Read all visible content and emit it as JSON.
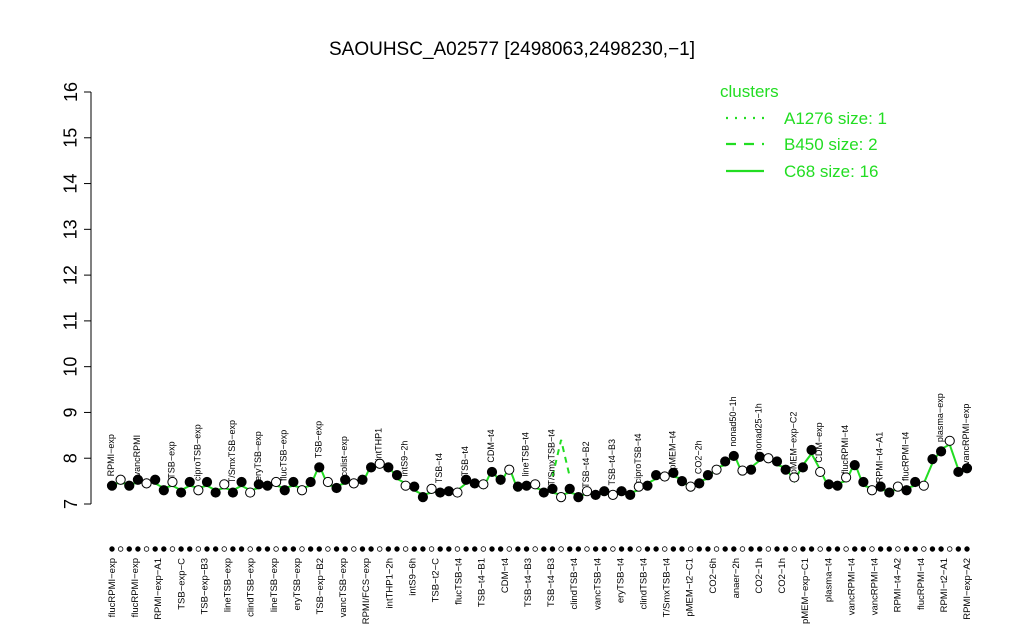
{
  "chart_data": {
    "type": "line",
    "title": "SAOUHSC_A02577 [2498063,2498230,−1]",
    "xlabel": "",
    "ylabel": "",
    "ylim": [
      7,
      16
    ],
    "yticks": [
      "7",
      "8",
      "9",
      "10",
      "11",
      "12",
      "13",
      "14",
      "15",
      "16"
    ],
    "grid": false,
    "legend": {
      "title": "clusters",
      "position": "top-right",
      "entries": [
        {
          "label": "A1276 size: 1",
          "style": "dotted"
        },
        {
          "label": "B450 size: 2",
          "style": "dashed"
        },
        {
          "label": "C68 size: 16",
          "style": "solid"
        }
      ]
    },
    "line_color": "#22dd22",
    "x_tick_labels": [
      "flucRPMI−exp",
      "flucRPMI−exp",
      "RPMI−exp−A1",
      "TSB−exp−C",
      "TSB−exp−B3",
      "lineTSB−exp",
      "clindTSB−exp",
      "lineTSB−exp",
      "eryTSB−exp",
      "TSB−exp−B2",
      "vancTSB−exp",
      "RPMI/FCS−exp",
      "intTHP1−2h",
      "intS9−6h",
      "TSB−t2−C",
      "flucTSB−t4",
      "TSB−t4−B1",
      "CDM−t4",
      "TSB−t4−B3",
      "TSB−t4−B3",
      "clindTSB−t4",
      "vancTSB−t4",
      "eryTSB−t4",
      "clindTSB−t4",
      "T/SmxTSB−t4",
      "pMEM−t2−C1",
      "CO2−6h",
      "anaer−2h",
      "CO2−1h",
      "CO2−1h",
      "pMEM−exp−C1",
      "plasma−t4",
      "vancRPMI−t4",
      "vancRPMI−t4",
      "RPMI−t4−A2",
      "flucRPMI−t4",
      "RPMI−t2−A1",
      "RPMI−exp−A2"
    ],
    "point_labels": [
      "RPMI−exp",
      "vancRPMI",
      "TSB−exp",
      "ciproTSB−exp",
      "T/SmxTSB−exp",
      "eryTSB−exp",
      "flucTSB−exp",
      "TSB−exp",
      "colist−exp",
      "intTHP1",
      "intS9−2h",
      "TSB−t4",
      "TSB−t4",
      "CDM−t4",
      "lineTSB−t4",
      "T/SmxTSB−t4",
      "TSB−t4−B2",
      "TSB−t4−B3",
      "ciproTSB−t4",
      "pMEM−t4",
      "CO2−2h",
      "nonad50−1h",
      "nonad25−1h",
      "pMEM−exp−C2",
      "CDM−exp",
      "flucRPMI−t4",
      "RPMI−t4−A1",
      "flucRPMI−t4",
      "plasma−exp",
      "vancRPMI−exp"
    ],
    "series": [
      {
        "name": "C68 size: 16",
        "style": "solid",
        "x": [
          0,
          1,
          2,
          3,
          4,
          5,
          6,
          7,
          8,
          9,
          10,
          11,
          12,
          13,
          14,
          15,
          16,
          17,
          18,
          19,
          20,
          21,
          22,
          23,
          24,
          25,
          26,
          27,
          28,
          29,
          30,
          31,
          32,
          33,
          34,
          35,
          36,
          37,
          38,
          39,
          40,
          41,
          42,
          43,
          44,
          45,
          46,
          47,
          48,
          49,
          50,
          51,
          52,
          53,
          54,
          55,
          56,
          57,
          58,
          59,
          60,
          61,
          62,
          63,
          64,
          65,
          66,
          67,
          68,
          69,
          70,
          71,
          72,
          73,
          74,
          75,
          76,
          77,
          78,
          79,
          80,
          81,
          82,
          83,
          84,
          85,
          86,
          87,
          88,
          89,
          90,
          91,
          92,
          93,
          94,
          95,
          96,
          97,
          98,
          99
        ],
        "y": [
          7.45,
          7.45,
          7.45,
          7.45,
          7.5,
          7.45,
          7.35,
          7.4,
          7.3,
          7.4,
          7.35,
          7.4,
          7.3,
          7.35,
          7.3,
          7.4,
          7.3,
          7.35,
          7.45,
          7.4,
          7.35,
          7.4,
          7.35,
          7.4,
          7.85,
          7.4,
          7.4,
          7.45,
          7.5,
          7.45,
          7.85,
          7.8,
          7.85,
          7.55,
          7.45,
          7.3,
          7.2,
          7.25,
          7.3,
          7.2,
          7.3,
          7.45,
          7.5,
          7.35,
          7.75,
          7.45,
          7.8,
          7.3,
          7.45,
          7.35,
          7.3,
          7.25,
          7.2,
          7.25,
          7.2,
          7.2,
          7.25,
          7.2,
          7.25,
          7.2,
          7.25,
          7.3,
          7.45,
          7.55,
          7.65,
          7.6,
          7.55,
          7.3,
          7.5,
          7.55,
          7.8,
          7.85,
          8.1,
          7.65,
          7.8,
          7.95,
          8.05,
          7.85,
          7.8,
          7.5,
          7.85,
          8.1,
          7.75,
          7.35,
          7.45,
          7.5,
          7.9,
          7.4,
          7.35,
          7.3,
          7.3,
          7.3,
          7.35,
          7.4,
          7.45,
          7.9,
          8.2,
          8.3,
          7.75,
          7.7
        ]
      },
      {
        "name": "B450 size: 2",
        "style": "dashed",
        "x": [
          51,
          52,
          53
        ],
        "y": [
          7.6,
          8.4,
          7.6
        ]
      },
      {
        "name": "A1276 size: 1",
        "style": "dotted",
        "x": [],
        "y": []
      }
    ]
  }
}
